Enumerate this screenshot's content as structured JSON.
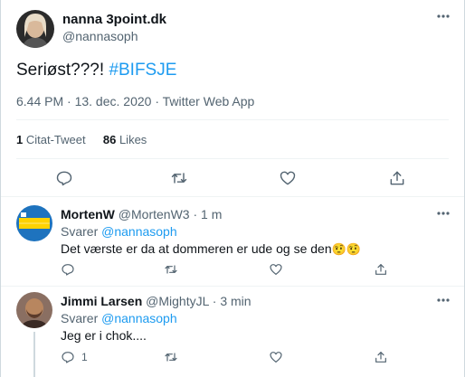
{
  "main_tweet": {
    "display_name": "nanna 3point.dk",
    "handle": "@nannasoph",
    "text_plain": "Seriøst???! ",
    "hashtag": "#BIFSJE",
    "timestamp": "6.44 PM · 13. dec. 2020 · Twitter Web App",
    "quote_count": "1",
    "quote_label": "Citat-Tweet",
    "like_count": "86",
    "like_label": "Likes"
  },
  "replies": [
    {
      "display_name": "MortenW",
      "handle": "@MortenW3",
      "separator": "·",
      "time": "1 m",
      "reply_prefix": "Svarer",
      "reply_to": "@nannasoph",
      "text": "Det værste er da at dommeren er ude og se den",
      "emoji": "🤨🤨",
      "reply_count": ""
    },
    {
      "display_name": "Jimmi Larsen",
      "handle": "@MightyJL",
      "separator": "·",
      "time": "3 min",
      "reply_prefix": "Svarer",
      "reply_to": "@nannasoph",
      "text": "Jeg er i chok....",
      "reply_count": "1"
    }
  ],
  "icons": [
    "more-icon",
    "reply-icon",
    "retweet-icon",
    "like-icon",
    "share-icon"
  ],
  "colors": {
    "accent": "#1d9bf0",
    "muted": "#536471",
    "text": "#0f1419",
    "divider": "#eff3f4"
  }
}
